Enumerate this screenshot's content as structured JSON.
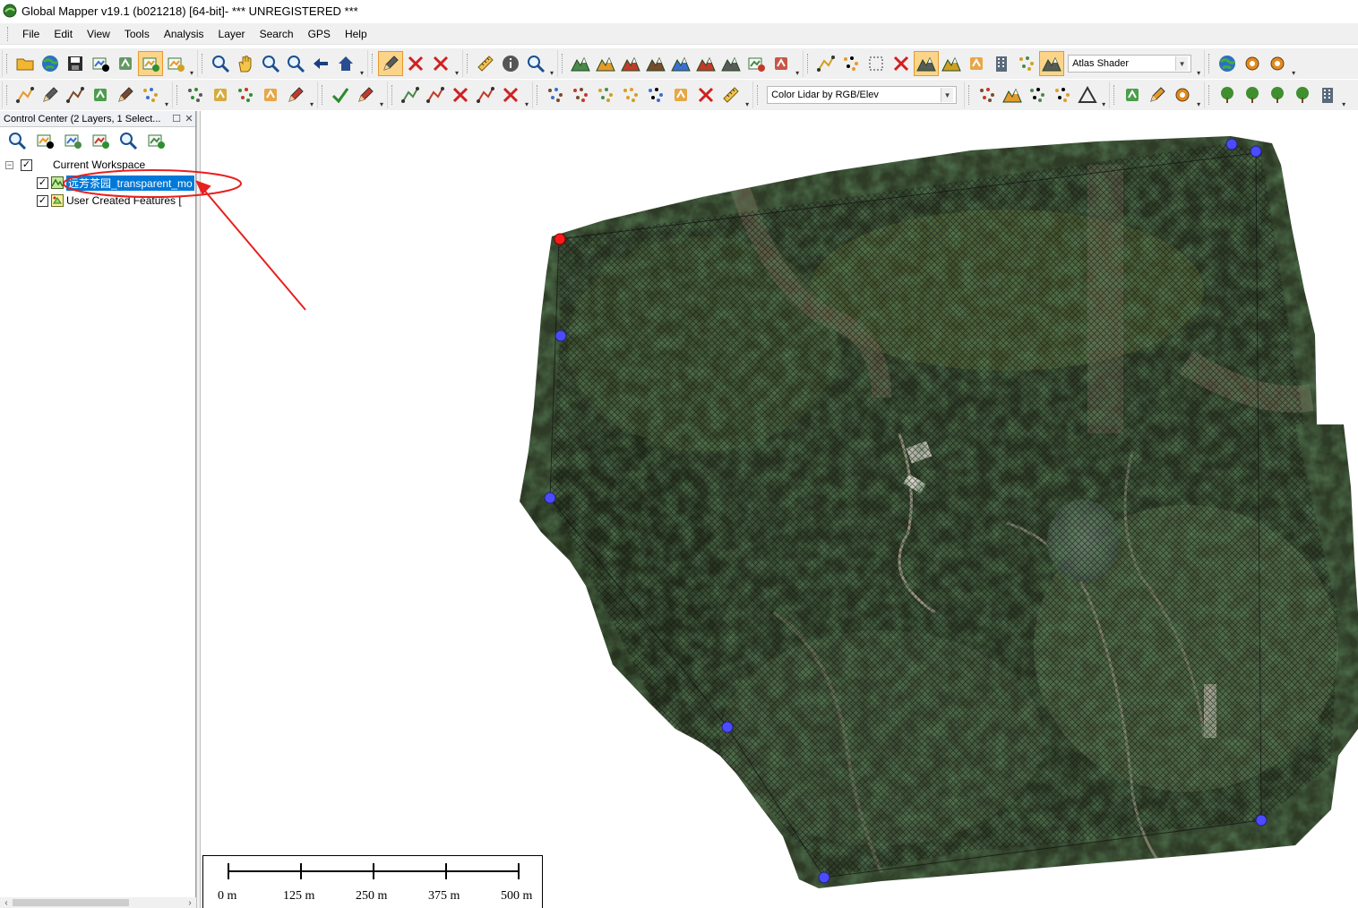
{
  "window": {
    "title": "Global Mapper v19.1 (b021218) [64-bit]- *** UNREGISTERED ***"
  },
  "menu": [
    "File",
    "Edit",
    "View",
    "Tools",
    "Analysis",
    "Layer",
    "Search",
    "GPS",
    "Help"
  ],
  "toolbar": {
    "shader_select": "Atlas Shader",
    "lidar_select": "Color Lidar by RGB/Elev",
    "row1_icons": [
      [
        "open-folder-icon",
        "globe-icon",
        "save-icon",
        "export-icon",
        "wrench-icon",
        "overlay-control-icon",
        "workspace-icon"
      ],
      [
        "zoom-box-icon",
        "pan-hand-icon",
        "zoom-in-icon",
        "zoom-out-icon",
        "back-arrow-icon",
        "home-icon"
      ],
      [
        "digitizer-pencil-icon",
        "select-box-icon",
        "delete-feature-icon"
      ],
      [
        "measure-ruler-icon",
        "feature-info-icon",
        "search-features-icon"
      ],
      [
        "path-profile-icon",
        "terrain-icon",
        "volume-icon",
        "watershed-icon",
        "view-shed-icon",
        "contour-icon",
        "combine-terrain-icon",
        "3d-view-icon",
        "gps-icon"
      ],
      [
        "split-view-icon",
        "pointer-icon",
        "crop-icon",
        "3d-box-icon",
        "slope-shader-icon",
        "daylight-shader-icon",
        "elevation-legend-icon",
        "building-icon",
        "lidar-icon",
        "atlas-shader-icon"
      ],
      [
        "world-icon",
        "settings-gear-icon",
        "config-icon"
      ]
    ],
    "row2_icons": [
      [
        "create-line-icon",
        "edit-line-icon",
        "reshape-line-icon",
        "create-area-icon",
        "paint-line-icon",
        "point-icon"
      ],
      [
        "create-point-icon",
        "range-ring-icon",
        "grid-icon",
        "pin-icon",
        "area-edit-icon"
      ],
      [
        "check-icon",
        "brush-icon"
      ],
      [
        "move-icon",
        "scale-icon",
        "vertex-icon",
        "split-icon",
        "cross-icon"
      ],
      [
        "segment-icon",
        "snap-icon",
        "point-cloud-icon",
        "filter-points-icon",
        "classify-icon",
        "copy-icon",
        "square-vertex-icon",
        "measure-tape-icon"
      ],
      [
        "point-grid-icon",
        "mountain-icon",
        "lidar-classify-icon",
        "mesh-icon",
        "triangle-icon"
      ],
      [
        "funnel-icon",
        "edit-note-icon",
        "settings-bug-icon"
      ],
      [
        "tree-dark-icon",
        "grass-icon",
        "shrub-icon",
        "tree-icon",
        "building-tall-icon"
      ]
    ]
  },
  "control_center": {
    "title": "Control Center (2 Layers, 1 Select...",
    "tools": [
      "layer-zoom-icon",
      "add-layer-icon",
      "close-layer-icon",
      "layer-options-icon",
      "find-layer-icon",
      "show-layer-icon"
    ],
    "workspace": "Current Workspace",
    "layers": [
      {
        "name": "远芳茶园_transparent_mo",
        "checked": true,
        "selected": true
      },
      {
        "name": "User Created Features [",
        "checked": true,
        "selected": false
      }
    ]
  },
  "scale_bar": {
    "labels": [
      "0 m",
      "125 m",
      "250 m",
      "375 m",
      "500 m"
    ]
  },
  "colors": {
    "selection": "#0078d7",
    "annotation_red": "#e8201e",
    "vertex_blue": "#4b4bff",
    "vertex_red": "#ff1a1a",
    "active_tool": "#fbd48a",
    "toolbar_bg": "#f0f0f0"
  }
}
